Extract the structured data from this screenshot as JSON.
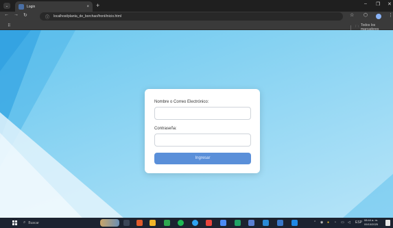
{
  "browser": {
    "tab": {
      "title": "Login",
      "close_glyph": "×"
    },
    "new_tab_glyph": "+",
    "window_controls": {
      "minimize": "–",
      "restore": "❐",
      "close": "✕"
    },
    "nav": {
      "back": "←",
      "forward": "→",
      "reload": "↻",
      "info": "ⓘ"
    },
    "url": "localhost/planta_de_borchao/front/inicio.html",
    "toolbar_icons": {
      "star": "☆",
      "extensions": "⬡",
      "menu": "⋮"
    },
    "bookmarks": {
      "apps_glyph": "⠿",
      "all_bookmarks": "Todos los marcadores"
    }
  },
  "login": {
    "email_label": "Nombre o Correo Electrónico:",
    "email_value": "",
    "password_label": "Contraseña:",
    "password_value": "",
    "submit_label": "Ingresar"
  },
  "taskbar": {
    "search_placeholder": "Buscar",
    "lang": "ESP",
    "time": "08:44 a. m.",
    "date": "09/10/2025"
  },
  "colors": {
    "accent_button": "#5a8fd9",
    "background_light": "#8ed5f3",
    "background_dark": "#3aa7e3",
    "browser_chrome": "#3a3a3a"
  }
}
